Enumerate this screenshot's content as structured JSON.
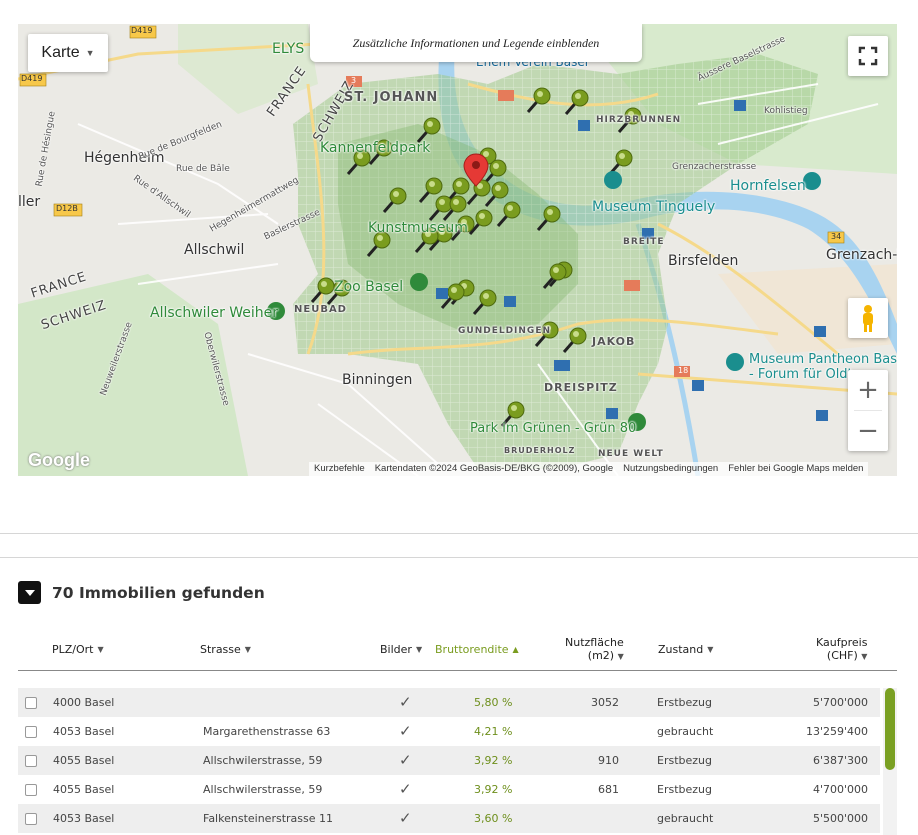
{
  "map": {
    "type_button": "Karte",
    "legend_toggle": "Zusätzliche Informationen und Legende einblenden",
    "zoom_in": "+",
    "zoom_out": "−",
    "google_logo": "Google",
    "attribution": [
      "Kurzbefehle",
      "Kartendaten ©2024 GeoBasis-DE/BKG (©2009), Google",
      "Nutzungsbedingungen",
      "Fehler bei Google Maps melden"
    ],
    "labels": {
      "elys": "ELYS",
      "st_johann": "ST. JOHANN",
      "hegenheim": "Hégenheim",
      "iller": "ller",
      "allschwil": "Allschwil",
      "france": "FRANCE",
      "schweiz": "SCHWEIZ",
      "france_border": "FRANCE",
      "schweiz_border": "SCHWEIZ",
      "schweiz_top": "SCHWEIZ",
      "kannenfeldpark": "Kannenfeldpark",
      "kunstmuseum": "Kunstmuseum",
      "zoo_basel": "Zoo Basel",
      "neubad": "NEUBAD",
      "allschwiler_weiher": "Allschwiler Weiher",
      "binningen": "Binningen",
      "gundeldingen": "GUNDELDINGEN",
      "jakob": "JAKOB",
      "dreispitz": "DREISPITZ",
      "park_gruenen": "Park im Grünen - Grün 80",
      "neue_welt": "NEUE WELT",
      "bruderholz": "BRUDERHOLZ",
      "museum_tinguely": "Museum Tinguely",
      "hornfelsen": "Hornfelsen",
      "birsfelden": "Birsfelden",
      "grenzach": "Grenzach-W",
      "breite": "BREITE",
      "hirzbrunnen": "HIRZBRUNNEN",
      "pantheon_1": "Museum Pantheon Base",
      "pantheon_2": "- Forum für Oldt",
      "ehem_verein": "Ehem Verein Basel",
      "d419_a": "D419",
      "d419_b": "D419",
      "d12b": "D12B",
      "r3": "3",
      "r18": "18",
      "r34": "34",
      "rue_bourgfelden": "Rue de Bourgfelden",
      "rue_bale": "Rue de Bâle",
      "rue_allschwil": "Rue d'Allschwil",
      "hegenheimermattweg": "Hegenheimermattweg",
      "baslerstrasse": "Baslerstrasse",
      "neuweilerstrasse": "Neuweilerstrasse",
      "oberwilerstrasse": "Oberwilerstrasse",
      "grenzacherstrasse": "Grenzacherstrasse",
      "kohlistieg": "Kohlistieg",
      "aeussere_baselstrasse": "Äussere Baselstrasse",
      "rue_hesingue": "Rue de Hésingue"
    },
    "colors": {
      "pin": "#7a9c1f",
      "pin_dark": "#4d6a0e",
      "marker_red": "#e53935",
      "grid_green": "#9fc88a"
    }
  },
  "results": {
    "count_title": "70 Immobilien gefunden",
    "columns": {
      "plz": "PLZ/Ort",
      "strasse": "Strasse",
      "bilder": "Bilder",
      "rendite": "Bruttorendite",
      "nutzflaeche_1": "Nutzfläche",
      "nutzflaeche_2": "(m2)",
      "zustand": "Zustand",
      "kaufpreis_1": "Kaufpreis",
      "kaufpreis_2": "(CHF)"
    },
    "rows": [
      {
        "plz": "4000 Basel",
        "strasse": "",
        "bilder": "✓",
        "rendite": "5,80 %",
        "flaeche": "3052",
        "zustand": "Erstbezug",
        "preis": "5'700'000"
      },
      {
        "plz": "4053 Basel",
        "strasse": "Margarethenstrasse 63",
        "bilder": "✓",
        "rendite": "4,21 %",
        "flaeche": "",
        "zustand": "gebraucht",
        "preis": "13'259'400"
      },
      {
        "plz": "4055 Basel",
        "strasse": "Allschwilerstrasse, 59",
        "bilder": "✓",
        "rendite": "3,92 %",
        "flaeche": "910",
        "zustand": "Erstbezug",
        "preis": "6'387'300"
      },
      {
        "plz": "4055 Basel",
        "strasse": "Allschwilerstrasse, 59",
        "bilder": "✓",
        "rendite": "3,92 %",
        "flaeche": "681",
        "zustand": "Erstbezug",
        "preis": "4'700'000"
      },
      {
        "plz": "4053 Basel",
        "strasse": "Falkensteinerstrasse 11",
        "bilder": "✓",
        "rendite": "3,60 %",
        "flaeche": "",
        "zustand": "gebraucht",
        "preis": "5'500'000"
      }
    ]
  }
}
